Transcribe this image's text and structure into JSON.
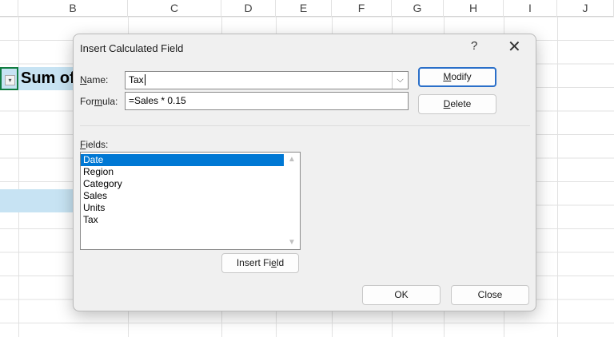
{
  "sheet": {
    "columns": [
      "B",
      "C",
      "D",
      "E",
      "F",
      "G",
      "H",
      "I",
      "J"
    ],
    "cell_text": "Sum of"
  },
  "dialog": {
    "title": "Insert Calculated Field",
    "help": "?",
    "name_label": {
      "pre": "",
      "ul": "N",
      "post": "ame:"
    },
    "name_value": "Tax",
    "formula_label": {
      "pre": "For",
      "ul": "m",
      "post": "ula:"
    },
    "formula_value": "=Sales * 0.15",
    "modify": {
      "pre": "",
      "ul": "M",
      "post": "odify"
    },
    "delete": {
      "pre": "",
      "ul": "D",
      "post": "elete"
    },
    "fields_label": {
      "pre": "",
      "ul": "F",
      "post": "ields:"
    },
    "fields": [
      "Date",
      "Region",
      "Category",
      "Sales",
      "Units",
      "Tax"
    ],
    "selected_field": "Date",
    "insert_field": {
      "pre": "Insert Fi",
      "ul": "e",
      "post": "ld"
    },
    "ok": "OK",
    "close": "Close"
  }
}
